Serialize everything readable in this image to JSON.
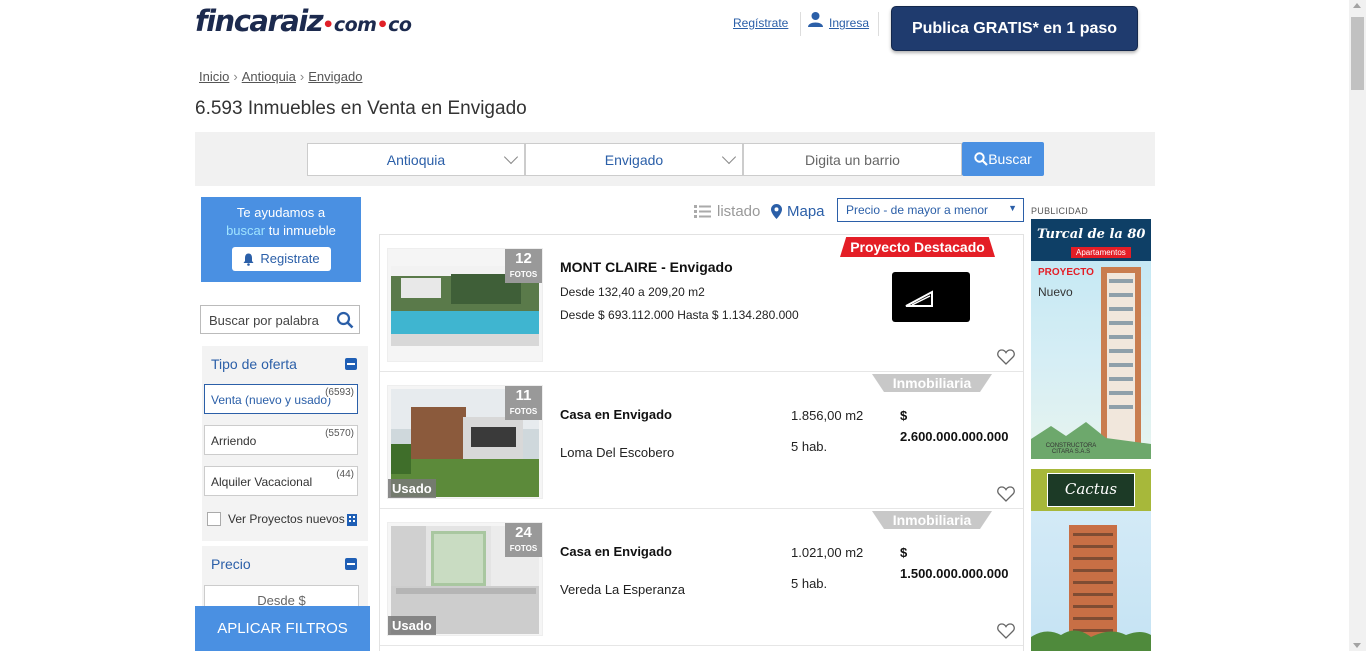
{
  "header": {
    "logo_main": "fincaraiz",
    "logo_dom": "com",
    "logo_tld": "co",
    "register_link": "Regístrate",
    "login_link": "Ingresa",
    "publish_button": "Publica GRATIS* en 1 paso"
  },
  "breadcrumb": [
    "Inicio",
    "Antioquia",
    "Envigado"
  ],
  "page_title": "6.593 Inmuebles en Venta en Envigado",
  "search": {
    "department": "Antioquia",
    "city": "Envigado",
    "barrio_placeholder": "Digita un barrio",
    "button": "Buscar"
  },
  "sidebar": {
    "help_line1": "Te ayudamos a",
    "help_highlight": "buscar",
    "help_rest": " tu inmueble",
    "help_button": "Registrate",
    "keyword_placeholder": "Buscar por palabra",
    "offer_title": "Tipo de oferta",
    "offers": [
      {
        "label": "Venta (nuevo y usado)",
        "count": "(6593)"
      },
      {
        "label": "Arriendo",
        "count": "(5570)"
      },
      {
        "label": "Alquiler Vacacional",
        "count": "(44)"
      }
    ],
    "projects_label": "Ver Proyectos nuevos",
    "price_title": "Precio",
    "price_from": "Desde $",
    "apply_button": "APLICAR FILTROS"
  },
  "toolbar": {
    "list_view": "listado",
    "map_view": "Mapa",
    "sort": "Precio - de mayor a menor"
  },
  "listings": [
    {
      "photos": "12",
      "photos_label": "FOTOS",
      "badge": "Proyecto Destacado",
      "title": "MONT CLAIRE - Envigado",
      "area": "Desde 132,40 a 209,20 m2",
      "price_range": "Desde $ 693.112.000 Hasta $ 1.134.280.000"
    },
    {
      "photos": "11",
      "photos_label": "FOTOS",
      "badge": "Inmobiliaria",
      "condition": "Usado",
      "title": "Casa en Envigado",
      "location": "Loma Del Escobero",
      "area": "1.856,00 m2",
      "rooms": "5 hab.",
      "currency": "$",
      "price": "2.600.000.000.000"
    },
    {
      "photos": "24",
      "photos_label": "FOTOS",
      "badge": "Inmobiliaria",
      "condition": "Usado",
      "title": "Casa en Envigado",
      "location": "Vereda La Esperanza",
      "area": "1.021,00 m2",
      "rooms": "5 hab.",
      "currency": "$",
      "price": "1.500.000.000.000"
    }
  ],
  "ads": {
    "label": "PUBLICIDAD",
    "ad1_brand": "Turcal de la 80",
    "ad1_tag": "Apartamentos",
    "ad1_project": "PROYECTO",
    "ad1_new": "Nuevo",
    "ad1_builder": "CONSTRUCTORA CITARA S.A.S",
    "ad2_brand": "Cactus"
  },
  "colors": {
    "brand_navy": "#1f3b6e",
    "accent_blue": "#4a90e2",
    "link_blue": "#2b5fa8",
    "featured_red": "#e41e26"
  }
}
